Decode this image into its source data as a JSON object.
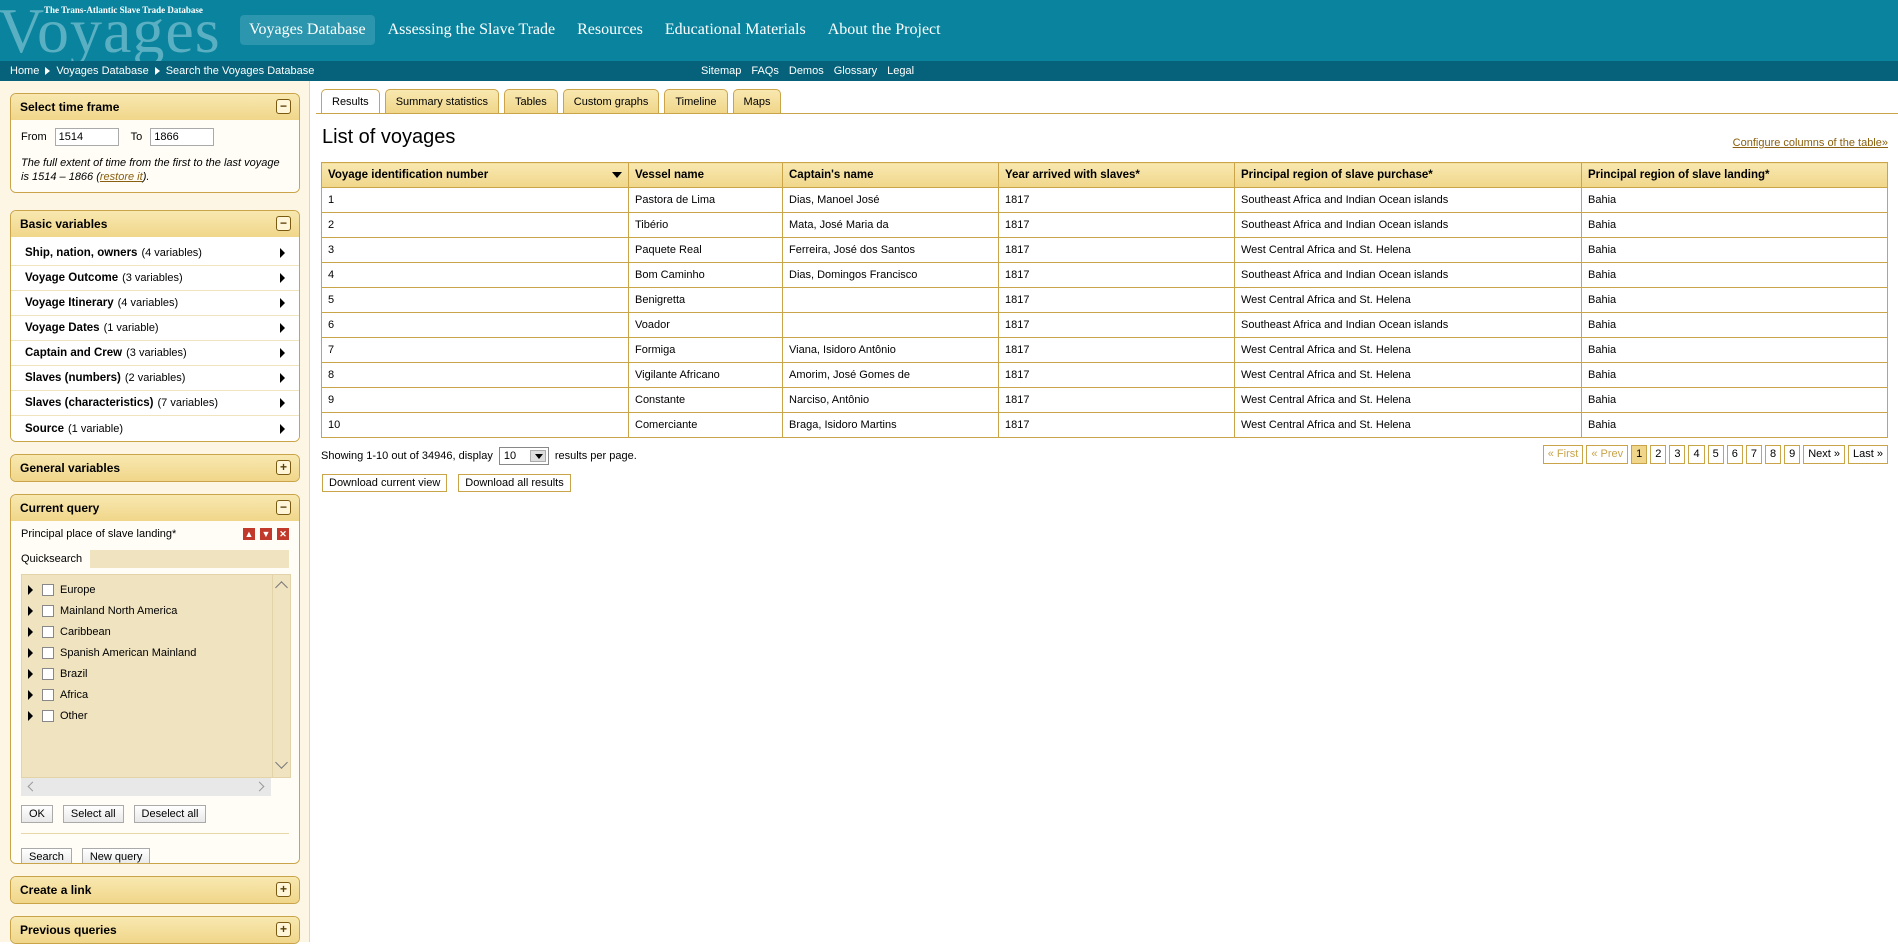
{
  "header": {
    "logo_small": "The Trans-Atlantic Slave Trade Database",
    "logo_big": "Voyages",
    "nav": [
      "Voyages Database",
      "Assessing the Slave Trade",
      "Resources",
      "Educational Materials",
      "About the Project"
    ]
  },
  "subbar": {
    "crumbs": [
      "Home",
      "Voyages Database",
      "Search the Voyages Database"
    ],
    "links": [
      "Sitemap",
      "FAQs",
      "Demos",
      "Glossary",
      "Legal"
    ]
  },
  "timeframe": {
    "title": "Select time frame",
    "from_label": "From",
    "from_value": "1514",
    "to_label": "To",
    "to_value": "1866",
    "note": "The full extent of time from the first to the last voyage is 1514 – 1866 (",
    "restore": "restore it",
    "note_end": ")."
  },
  "basic": {
    "title": "Basic variables",
    "items": [
      {
        "name": "Ship, nation, owners",
        "count": "(4 variables)"
      },
      {
        "name": "Voyage Outcome",
        "count": "(3 variables)"
      },
      {
        "name": "Voyage Itinerary",
        "count": "(4 variables)"
      },
      {
        "name": "Voyage Dates",
        "count": "(1 variable)"
      },
      {
        "name": "Captain and Crew",
        "count": "(3 variables)"
      },
      {
        "name": "Slaves (numbers)",
        "count": "(2 variables)"
      },
      {
        "name": "Slaves (characteristics)",
        "count": "(7 variables)"
      },
      {
        "name": "Source",
        "count": "(1 variable)"
      }
    ]
  },
  "general": {
    "title": "General variables"
  },
  "query": {
    "title": "Current query",
    "field": "Principal place of slave landing*",
    "quicksearch": "Quicksearch",
    "regions": [
      "Europe",
      "Mainland North America",
      "Caribbean",
      "Spanish American Mainland",
      "Brazil",
      "Africa",
      "Other"
    ],
    "ok": "OK",
    "select_all": "Select all",
    "deselect_all": "Deselect all",
    "search": "Search",
    "new_query": "New query"
  },
  "create_link": {
    "title": "Create a link"
  },
  "previous": {
    "title": "Previous queries"
  },
  "tabs": [
    "Results",
    "Summary statistics",
    "Tables",
    "Custom graphs",
    "Timeline",
    "Maps"
  ],
  "main": {
    "title": "List of voyages",
    "configure": "Configure columns of the table»",
    "columns": [
      "Voyage identification number",
      "Vessel name",
      "Captain's name",
      "Year arrived with slaves*",
      "Principal region of slave purchase*",
      "Principal region of slave landing*"
    ],
    "rows": [
      [
        "1",
        "Pastora de Lima",
        "Dias, Manoel José",
        "1817",
        "Southeast Africa and Indian Ocean islands",
        "Bahia"
      ],
      [
        "2",
        "Tibério",
        "Mata, José Maria da",
        "1817",
        "Southeast Africa and Indian Ocean islands",
        "Bahia"
      ],
      [
        "3",
        "Paquete Real",
        "Ferreira, José dos Santos",
        "1817",
        "West Central Africa and St. Helena",
        "Bahia"
      ],
      [
        "4",
        "Bom Caminho",
        "Dias, Domingos Francisco",
        "1817",
        "Southeast Africa and Indian Ocean islands",
        "Bahia"
      ],
      [
        "5",
        "Benigretta",
        "",
        "1817",
        "West Central Africa and St. Helena",
        "Bahia"
      ],
      [
        "6",
        "Voador",
        "",
        "1817",
        "Southeast Africa and Indian Ocean islands",
        "Bahia"
      ],
      [
        "7",
        "Formiga",
        "Viana, Isidoro Antônio",
        "1817",
        "West Central Africa and St. Helena",
        "Bahia"
      ],
      [
        "8",
        "Vigilante Africano",
        "Amorim, José Gomes de",
        "1817",
        "West Central Africa and St. Helena",
        "Bahia"
      ],
      [
        "9",
        "Constante",
        "Narciso, Antônio",
        "1817",
        "West Central Africa and St. Helena",
        "Bahia"
      ],
      [
        "10",
        "Comerciante",
        "Braga, Isidoro Martins",
        "1817",
        "West Central Africa and St. Helena",
        "Bahia"
      ]
    ],
    "showing": "Showing 1-10 out of 34946, display",
    "per_page_value": "10",
    "per_page_suffix": "results per page.",
    "pager": [
      "« First",
      "« Prev",
      "1",
      "2",
      "3",
      "4",
      "5",
      "6",
      "7",
      "8",
      "9",
      "Next »",
      "Last »"
    ],
    "download_view": "Download current view",
    "download_all": "Download all results"
  }
}
